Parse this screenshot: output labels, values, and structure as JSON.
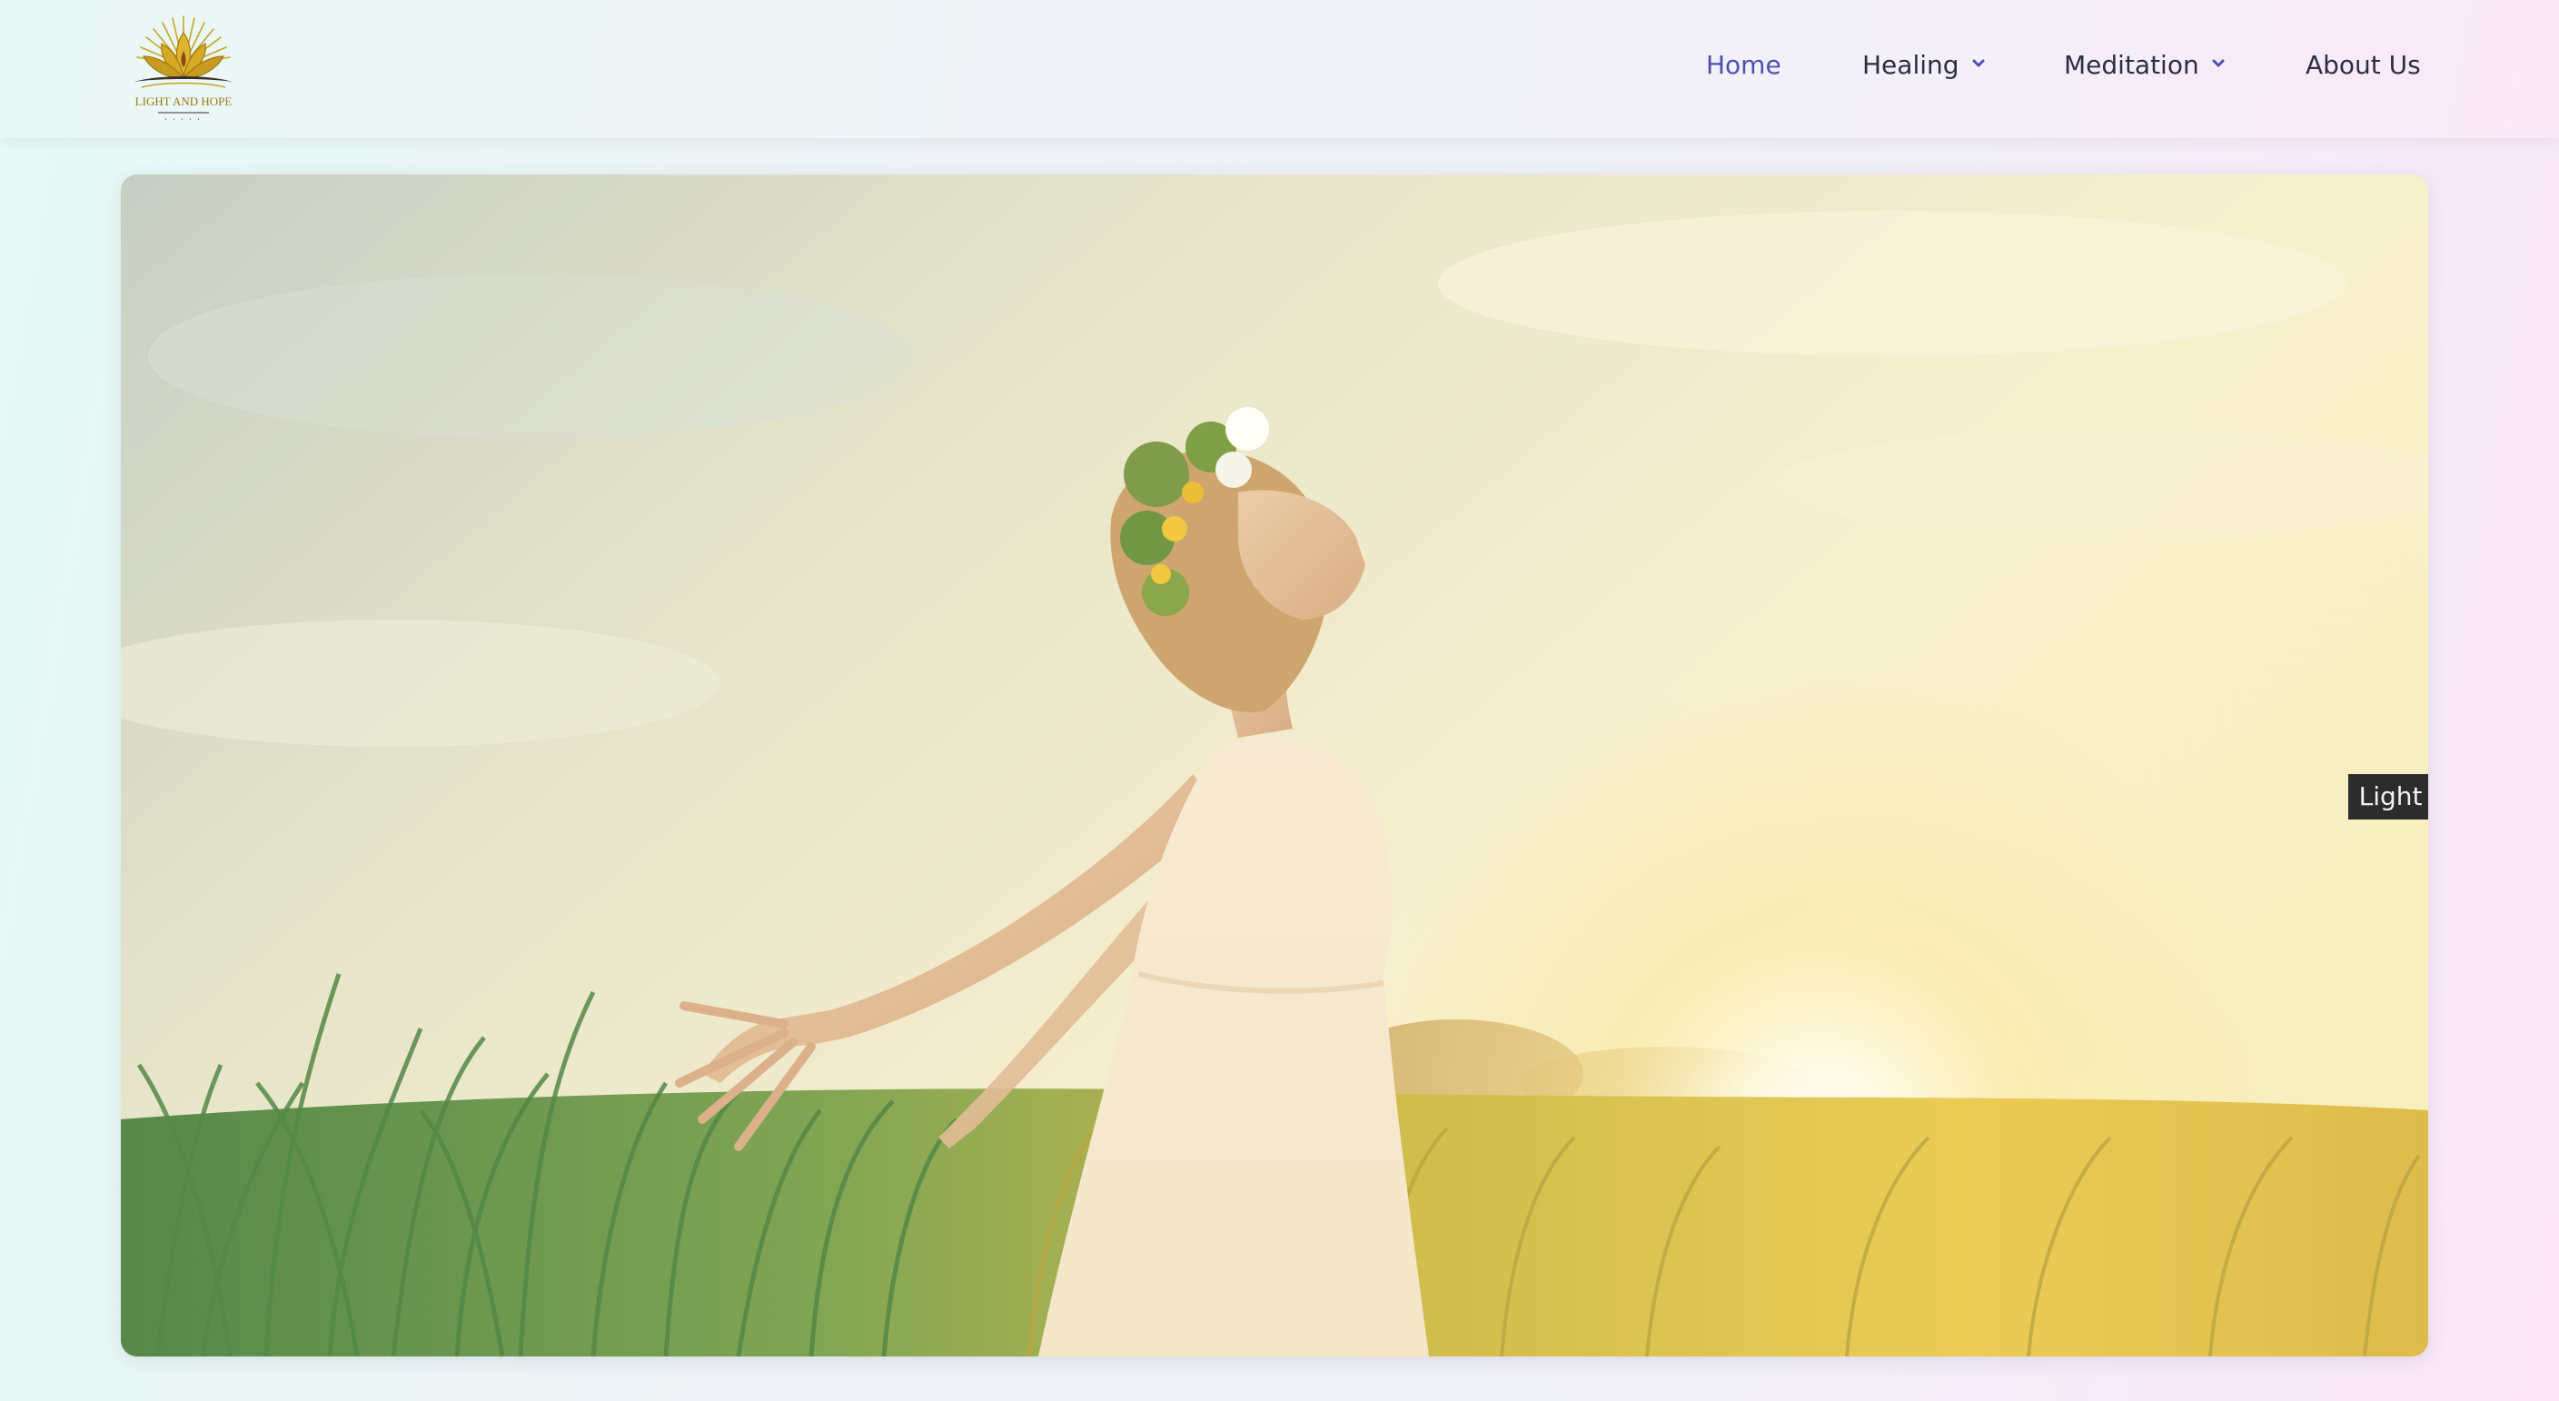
{
  "header": {
    "logo": {
      "text": "LIGHT AND HOPE",
      "icon": "lotus-sunburst-logo"
    },
    "nav": [
      {
        "label": "Home",
        "active": true
      },
      {
        "label": "Healing",
        "has_dropdown": true,
        "icon": "chevron-down-icon"
      },
      {
        "label": "Meditation",
        "has_dropdown": true,
        "icon": "chevron-down-icon"
      },
      {
        "label": "About Us"
      }
    ]
  },
  "hero": {
    "image_subject": "woman-in-field-at-sunset",
    "caption": "Light & Hope"
  },
  "colors": {
    "active_nav": "#4e4fb3",
    "nav_text": "#2b2f45",
    "chevron": "#4e4fb3",
    "caption_bg": "#2c2c2c",
    "logo_gold": "#c9a227"
  }
}
